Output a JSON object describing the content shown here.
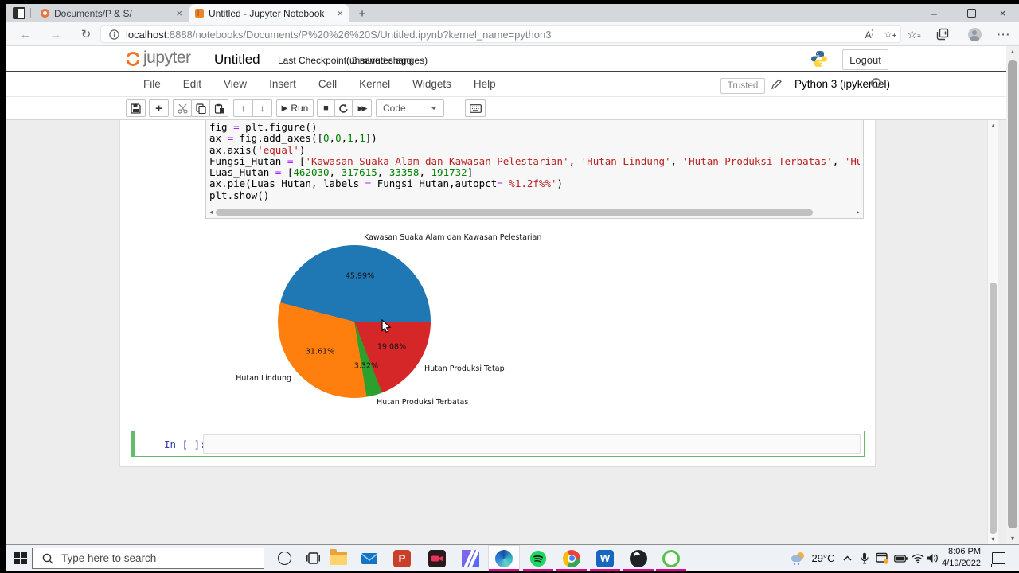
{
  "browser": {
    "tab1_title": "Documents/P & S/",
    "tab2_title": "Untitled - Jupyter Notebook",
    "close_glyph": "×",
    "new_tab_glyph": "+",
    "back_glyph": "←",
    "forward_glyph": "→",
    "refresh_glyph": "↻",
    "url_host": "localhost",
    "url_rest": ":8888/notebooks/Documents/P%20%26%20S/Untitled.ipynb?kernel_name=python3",
    "read_aloud_glyph": "A",
    "minimize_glyph": "–",
    "dots_glyph": "···"
  },
  "jupyter": {
    "logo_text": "jupyter",
    "title": "Untitled",
    "checkpoint": "Last Checkpoint: 3 minutes ago",
    "unsaved": "(unsaved changes)",
    "logout": "Logout",
    "menu": [
      "File",
      "Edit",
      "View",
      "Insert",
      "Cell",
      "Kernel",
      "Widgets",
      "Help"
    ],
    "trusted": "Trusted",
    "kernel_name": "Python 3 (ipykernel)",
    "run_label": "Run",
    "cell_type": "Code",
    "empty_prompt": "In [ ]:"
  },
  "code": {
    "lines": [
      [
        [
          "fig ",
          "p"
        ],
        [
          "=",
          "o"
        ],
        [
          " plt.figure()",
          "p"
        ]
      ],
      [
        [
          "ax ",
          "p"
        ],
        [
          "=",
          "o"
        ],
        [
          " fig.add_axes([",
          "p"
        ],
        [
          "0",
          "n"
        ],
        [
          ",",
          "p"
        ],
        [
          "0",
          "n"
        ],
        [
          ",",
          "p"
        ],
        [
          "1",
          "n"
        ],
        [
          ",",
          "p"
        ],
        [
          "1",
          "n"
        ],
        [
          "])",
          "p"
        ]
      ],
      [
        [
          "ax.axis(",
          "p"
        ],
        [
          "'equal'",
          "s"
        ],
        [
          ")",
          "p"
        ]
      ],
      [
        [
          "Fungsi_Hutan ",
          "p"
        ],
        [
          "=",
          "o"
        ],
        [
          " [",
          "p"
        ],
        [
          "'Kawasan Suaka Alam dan Kawasan Pelestarian'",
          "s"
        ],
        [
          ", ",
          "p"
        ],
        [
          "'Hutan Lindung'",
          "s"
        ],
        [
          ", ",
          "p"
        ],
        [
          "'Hutan Produksi Terbatas'",
          "s"
        ],
        [
          ", ",
          "p"
        ],
        [
          "'Hutan Produksi Tetap'",
          "s"
        ],
        [
          "]",
          "p"
        ]
      ],
      [
        [
          "Luas_Hutan ",
          "p"
        ],
        [
          "=",
          "o"
        ],
        [
          " [",
          "p"
        ],
        [
          "462030",
          "n"
        ],
        [
          ", ",
          "p"
        ],
        [
          "317615",
          "n"
        ],
        [
          ", ",
          "p"
        ],
        [
          "33358",
          "n"
        ],
        [
          ", ",
          "p"
        ],
        [
          "191732",
          "n"
        ],
        [
          "]",
          "p"
        ]
      ],
      [
        [
          "ax.pie(Luas_Hutan, labels ",
          "p"
        ],
        [
          "=",
          "o"
        ],
        [
          " Fungsi_Hutan,autopct",
          "p"
        ],
        [
          "=",
          "o"
        ],
        [
          "'%1.2f%%'",
          "s"
        ],
        [
          ")",
          "p"
        ]
      ],
      [
        [
          "plt.show()",
          "p"
        ]
      ]
    ]
  },
  "chart_data": {
    "type": "pie",
    "labels": [
      "Kawasan Suaka Alam dan Kawasan Pelestarian",
      "Hutan Lindung",
      "Hutan Produksi Terbatas",
      "Hutan Produksi Tetap"
    ],
    "values": [
      462030,
      317615,
      33358,
      191732
    ],
    "percent_labels": [
      "45.99%",
      "31.61%",
      "3.32%",
      "19.08%"
    ],
    "colors": [
      "#1f77b4",
      "#ff7f0e",
      "#2ca02c",
      "#d62728"
    ],
    "start_angle_deg": 0,
    "direction": "counterclockwise",
    "legend": "none",
    "title": ""
  },
  "taskbar": {
    "search_placeholder": "Type here to search",
    "temperature": "29°C",
    "time": "8:06 PM",
    "date": "4/19/2022",
    "accent_underline_color": "#e3008c"
  }
}
